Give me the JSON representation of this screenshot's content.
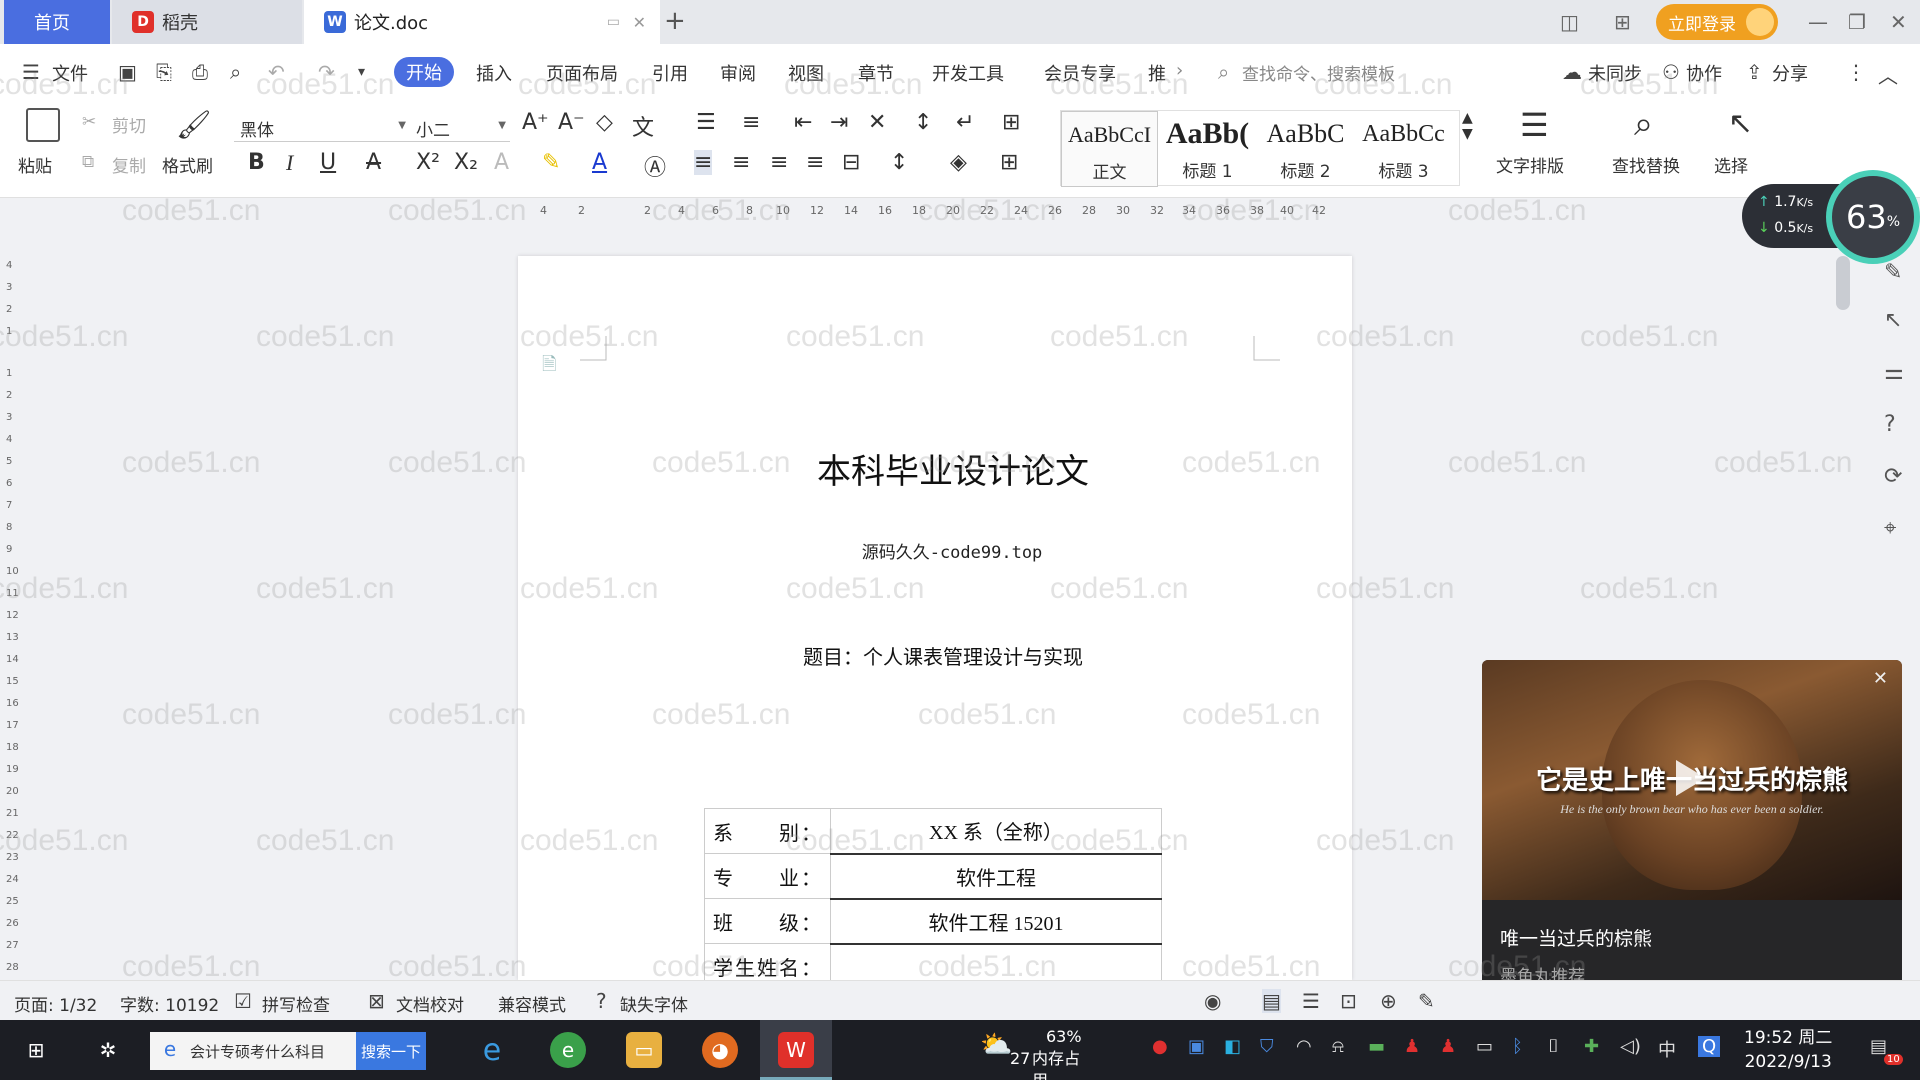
{
  "tabs": {
    "home": "首页",
    "daoke": "稻壳",
    "doc": "论文.doc",
    "login": "立即登录"
  },
  "menu": {
    "file": "文件",
    "items": [
      "开始",
      "插入",
      "页面布局",
      "引用",
      "审阅",
      "视图",
      "章节",
      "开发工具",
      "会员专享",
      "推"
    ],
    "search_cmd": "查找命令、搜索模板",
    "sync": "未同步",
    "collab": "协作",
    "share": "分享"
  },
  "ribbon": {
    "paste": "粘贴",
    "cut": "剪切",
    "copy": "复制",
    "format_painter": "格式刷",
    "font_name": "黑体",
    "font_size": "小二",
    "styles": [
      {
        "sample": "AaBbCcI",
        "name": "正文"
      },
      {
        "sample": "AaBb(",
        "name": "标题 1"
      },
      {
        "sample": "AaBbC",
        "name": "标题 2"
      },
      {
        "sample": "AaBbCc",
        "name": "标题 3"
      }
    ],
    "text_layout": "文字排版",
    "find_replace": "查找替换",
    "select": "选择"
  },
  "ruler": {
    "h_ticks": [
      "4",
      "2",
      "2",
      "4",
      "6",
      "8",
      "10",
      "12",
      "14",
      "16",
      "18",
      "20",
      "22",
      "24",
      "26",
      "28",
      "30",
      "32",
      "34",
      "36",
      "38",
      "40",
      "42"
    ],
    "v_ticks": [
      "4",
      "3",
      "2",
      "1",
      "1",
      "2",
      "3",
      "4",
      "5",
      "6",
      "7",
      "8",
      "9",
      "10",
      "11",
      "12",
      "13",
      "14",
      "15",
      "16",
      "17",
      "18",
      "19",
      "20",
      "21",
      "22",
      "23",
      "24",
      "25",
      "26",
      "27",
      "28"
    ]
  },
  "document": {
    "title": "本科毕业设计论文",
    "subtitle": "源码久久-code99.top",
    "topic": "题目：个人课表管理设计与实现",
    "table": [
      {
        "key": "系　　别：",
        "value": "XX 系（全称）"
      },
      {
        "key": "专　　业：",
        "value": "软件工程"
      },
      {
        "key": "班　　级：",
        "value": "软件工程 15201"
      },
      {
        "key": "学生姓名：",
        "value": ""
      }
    ]
  },
  "speed": {
    "up": "1.7",
    "down": "0.5",
    "unit": "K/s",
    "percent": "63"
  },
  "video": {
    "caption": "它是史上唯一当过兵的棕熊",
    "caption_en": "He is the only brown bear who has ever been a soldier.",
    "title": "唯一当过兵的棕熊",
    "source": "墨鱼丸推荐"
  },
  "status": {
    "page": "页面: 1/32",
    "words": "字数: 10192",
    "spell": "拼写检查",
    "proof": "文档校对",
    "compat": "兼容模式",
    "missing_font": "缺失字体"
  },
  "taskbar": {
    "search_text": "会计专硕考什么科目",
    "search_btn": "搜索一下",
    "weather_pct": "63%",
    "weather_temp": "27°C 多云",
    "weather_mem": "内存占用",
    "ime": "中",
    "time": "19:52 周二",
    "date": "2022/9/13",
    "notif": "10"
  },
  "watermark": "code51.cn",
  "colors": {
    "accent": "#4a6ee0",
    "login": "#f0a020",
    "wps_red": "#e0302a"
  }
}
